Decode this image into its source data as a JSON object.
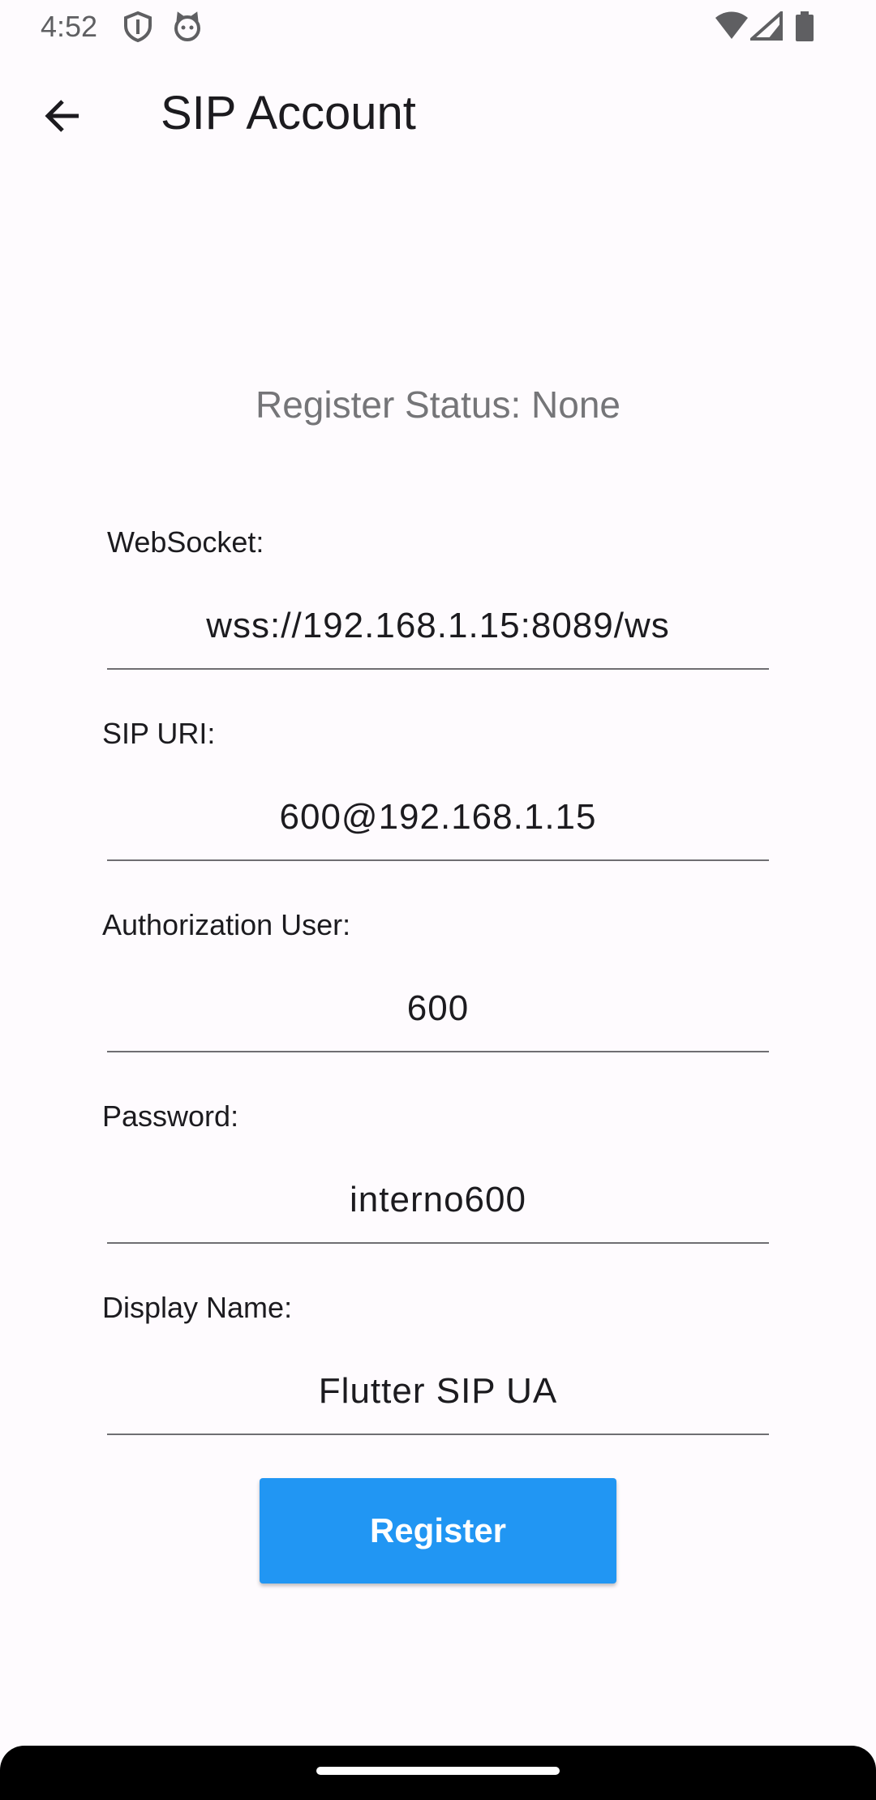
{
  "status_bar": {
    "time": "4:52",
    "icons": [
      "shield-icon",
      "cat-icon",
      "wifi-icon",
      "signal-icon",
      "battery-icon"
    ]
  },
  "app_bar": {
    "title": "SIP Account",
    "back_icon": "arrow-back-icon"
  },
  "register_status": "Register Status: None",
  "fields": {
    "websocket": {
      "label": "WebSocket:",
      "value": "wss://192.168.1.15:8089/ws"
    },
    "sip_uri": {
      "label": "SIP URI:",
      "value": "600@192.168.1.15"
    },
    "auth_user": {
      "label": "Authorization User:",
      "value": "600"
    },
    "password": {
      "label": "Password:",
      "value": "interno600"
    },
    "display_name": {
      "label": "Display Name:",
      "value": "Flutter SIP UA"
    }
  },
  "register_button": {
    "label": "Register"
  },
  "colors": {
    "accent": "#2196f3",
    "background": "#fefbfe",
    "status_text": "#757578"
  }
}
